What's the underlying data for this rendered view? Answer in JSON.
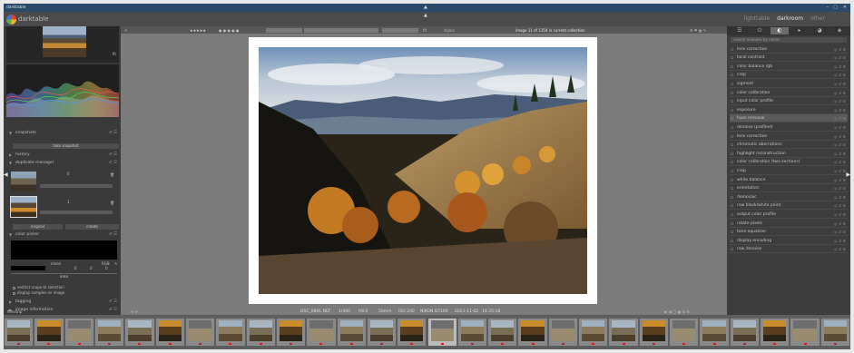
{
  "window": {
    "title": "darktable",
    "controls": [
      "–",
      "▢",
      "✕"
    ]
  },
  "app": {
    "name": "darktable",
    "views": [
      "lighttable",
      "darkroom",
      "other"
    ],
    "active_view": "darkroom"
  },
  "left_panel": {
    "navigation_zoom": "fit",
    "modules": {
      "snapshots": "snapshots",
      "take_snapshot": "take snapshot",
      "history": "history",
      "duplicate_manager": "duplicate manager",
      "duplicate_1_number": "0",
      "duplicate_2_number": "1",
      "original_btn": "original",
      "create_btn": "create",
      "color_picker": "color picker",
      "picker_mode": "mean",
      "picker_space": "RGB",
      "picker_values": [
        "0",
        "0",
        "0"
      ],
      "area_label": "area",
      "restrict_histogram": "restrict scope to selection",
      "display_samples": "display samples on image",
      "tagging": "tagging",
      "image_information": "image information",
      "mask_manager": "mask manager"
    }
  },
  "toolbar": {
    "stars": "★★★★★",
    "reject": "✕",
    "zoom_label": "fit",
    "style_label": "styles",
    "display_label": "display",
    "image_path": "image 11 of 1354 in current collection"
  },
  "image_info": {
    "filename": "DSC_0891.NEF",
    "shutter": "1/400",
    "aperture": "f/8.0",
    "focal": "50mm",
    "iso": "ISO 200",
    "camera": "NIKON D7100",
    "date": "2021-11-02",
    "time": "14:35:18"
  },
  "right_panel": {
    "search_placeholder": "search modules by name",
    "tabs": [
      "quick",
      "active",
      "base",
      "tone",
      "color",
      "correct",
      "effect"
    ],
    "active_tab": "base",
    "modules": [
      {
        "label": "lens correction",
        "highlight": false
      },
      {
        "label": "local contrast",
        "highlight": false
      },
      {
        "label": "color balance rgb",
        "highlight": false
      },
      {
        "label": "crop",
        "highlight": false
      },
      {
        "label": "sigmoid",
        "highlight": false
      },
      {
        "label": "color calibration",
        "highlight": false
      },
      {
        "label": "input color profile",
        "highlight": false
      },
      {
        "label": "exposure",
        "highlight": false
      },
      {
        "label": "haze removal",
        "highlight": true
      },
      {
        "label": "denoise (profiled)",
        "highlight": false
      },
      {
        "label": "lens correction",
        "highlight": false
      },
      {
        "label": "chromatic aberrations",
        "highlight": false
      },
      {
        "label": "highlight reconstruction",
        "highlight": false
      },
      {
        "label": "color calibration (two sections)",
        "highlight": false
      },
      {
        "label": "crop",
        "highlight": false
      },
      {
        "label": "white balance",
        "highlight": false
      },
      {
        "label": "orientation",
        "highlight": false
      },
      {
        "label": "demosaic",
        "highlight": false
      },
      {
        "label": "raw black/white point",
        "highlight": false
      },
      {
        "label": "output color profile",
        "highlight": false
      },
      {
        "label": "rotate pixels",
        "highlight": false
      },
      {
        "label": "tone equalizer",
        "highlight": false
      },
      {
        "label": "display encoding",
        "highlight": false
      },
      {
        "label": "raw denoise",
        "highlight": false
      }
    ]
  },
  "filmstrip": {
    "label": "filmstrip",
    "selected_index": 14,
    "thumbnail_count": 28
  },
  "colors": {
    "accent_red": "#c22222",
    "bg_dark": "#3a3a3a",
    "canvas_bg": "#7b7b7b"
  }
}
